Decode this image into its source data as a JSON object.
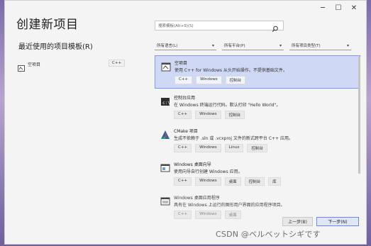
{
  "window": {
    "controls": [
      "─",
      "☐",
      "✕"
    ]
  },
  "page": {
    "title": "创建新项目",
    "recent_heading": "最近使用的项目模板(R)"
  },
  "recent": [
    {
      "name": "空项目",
      "lang": "C++"
    }
  ],
  "search": {
    "placeholder": "搜索模板(Alt+S)(S)"
  },
  "filters": [
    {
      "label": "所有语言(L)"
    },
    {
      "label": "所有平台(P)"
    },
    {
      "label": "所有项目类型(T)"
    }
  ],
  "projects": [
    {
      "name": "空项目",
      "desc": "使用 C++ for Windows 从头开始操作。不提供基础文件。",
      "tags": [
        "C++",
        "Windows",
        "控制台"
      ],
      "selected": true,
      "icon": "empty-project-icon"
    },
    {
      "name": "控制台应用",
      "desc": "在 Windows 终端运行代码。默认打印 \"Hello World\"。",
      "tags": [
        "C++",
        "Windows",
        "控制台"
      ],
      "icon": "console-app-icon"
    },
    {
      "name": "CMake 项目",
      "desc": "生成不依赖于 .sln 或 .vcxproj 文件的新式跨平台 C++ 应用。",
      "tags": [
        "C++",
        "Windows",
        "Linux",
        "控制台"
      ],
      "icon": "cmake-icon"
    },
    {
      "name": "Windows 桌面向导",
      "desc": "使用向导自行创建 Windows 应用。",
      "tags": [
        "C++",
        "Windows",
        "桌面",
        "控制台",
        "库"
      ],
      "icon": "desktop-wizard-icon"
    },
    {
      "name": "Windows 桌面应用程序",
      "desc": "具有在 Windows 上运行的图形用户界面的应用程序项目。",
      "tags": [
        "C++",
        "Windows",
        "桌面"
      ],
      "dim": true,
      "icon": "desktop-app-icon"
    }
  ],
  "buttons": {
    "back": "上一步(B)",
    "next": "下一步(N)"
  },
  "watermark": "CSDN @ベルベットシギです"
}
